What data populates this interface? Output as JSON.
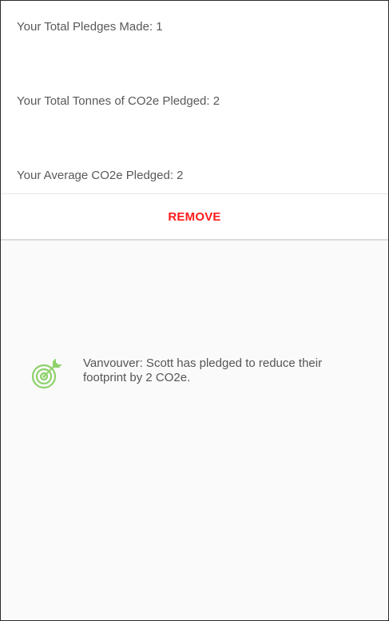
{
  "stats": {
    "total_pledges": "Your Total Pledges Made: 1",
    "total_tonnes": "Your Total Tonnes of CO2e Pledged: 2",
    "average": "Your Average CO2e Pledged: 2"
  },
  "actions": {
    "remove_label": "REMOVE"
  },
  "feed": {
    "items": [
      {
        "icon": "target-icon",
        "text": "Vanvouver: Scott has pledged to reduce their footprint by 2 CO2e."
      }
    ]
  },
  "colors": {
    "remove": "#ff1a1a",
    "icon": "#8ed16a",
    "text": "#595959"
  }
}
